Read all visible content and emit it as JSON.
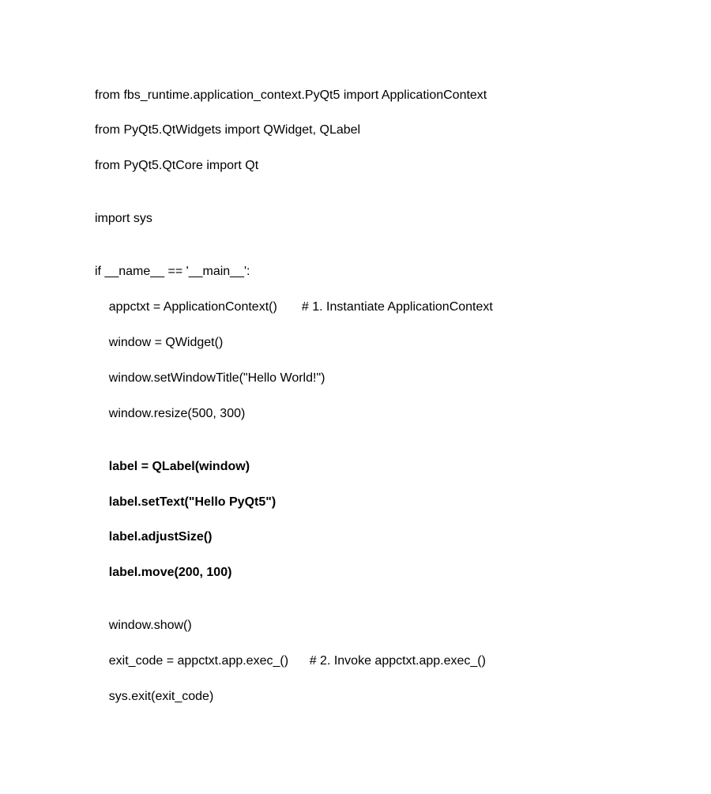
{
  "code": {
    "l1": "from fbs_runtime.application_context.PyQt5 import ApplicationContext",
    "l2": "from PyQt5.QtWidgets import QWidget, QLabel",
    "l3": "from PyQt5.QtCore import Qt",
    "l4": "",
    "l5": "import sys",
    "l6": "",
    "l7": "if __name__ == '__main__':",
    "l8": "    appctxt = ApplicationContext()       # 1. Instantiate ApplicationContext",
    "l9": "    window = QWidget()",
    "l10": "    window.setWindowTitle(\"Hello World!\")",
    "l11": "    window.resize(500, 300)",
    "l12": "",
    "l13": "    label = QLabel(window)",
    "l14": "    label.setText(\"Hello PyQt5\")",
    "l15": "    label.adjustSize()",
    "l16": "    label.move(200, 100)",
    "l17": "",
    "l18": "    window.show()",
    "l19": "    exit_code = appctxt.app.exec_()      # 2. Invoke appctxt.app.exec_()",
    "l20": "    sys.exit(exit_code)"
  }
}
